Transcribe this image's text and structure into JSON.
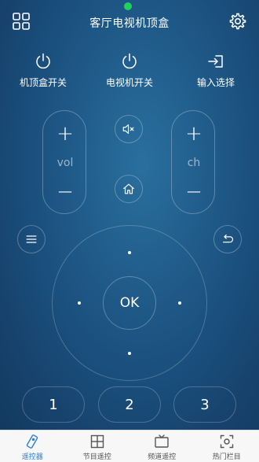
{
  "header": {
    "title": "客厅电视机顶盒"
  },
  "power_row": {
    "stb_power": "机顶盒开关",
    "tv_power": "电视机开关",
    "input_select": "输入选择"
  },
  "volume": {
    "plus": "+",
    "label": "vol",
    "minus": "−"
  },
  "channel": {
    "plus": "+",
    "label": "ch",
    "minus": "−"
  },
  "dpad": {
    "ok": "OK"
  },
  "number_pad": [
    "1",
    "2",
    "3"
  ],
  "tabs": [
    {
      "label": "遥控器",
      "icon": "remote-icon",
      "active": true
    },
    {
      "label": "节目遥控",
      "icon": "grid-icon",
      "active": false
    },
    {
      "label": "频道遥控",
      "icon": "tv-icon",
      "active": false
    },
    {
      "label": "热门栏目",
      "icon": "hot-icon",
      "active": false
    }
  ],
  "colors": {
    "accent": "#2a7fd4",
    "status_dot": "#1fd35a",
    "background": "#1d5584"
  }
}
